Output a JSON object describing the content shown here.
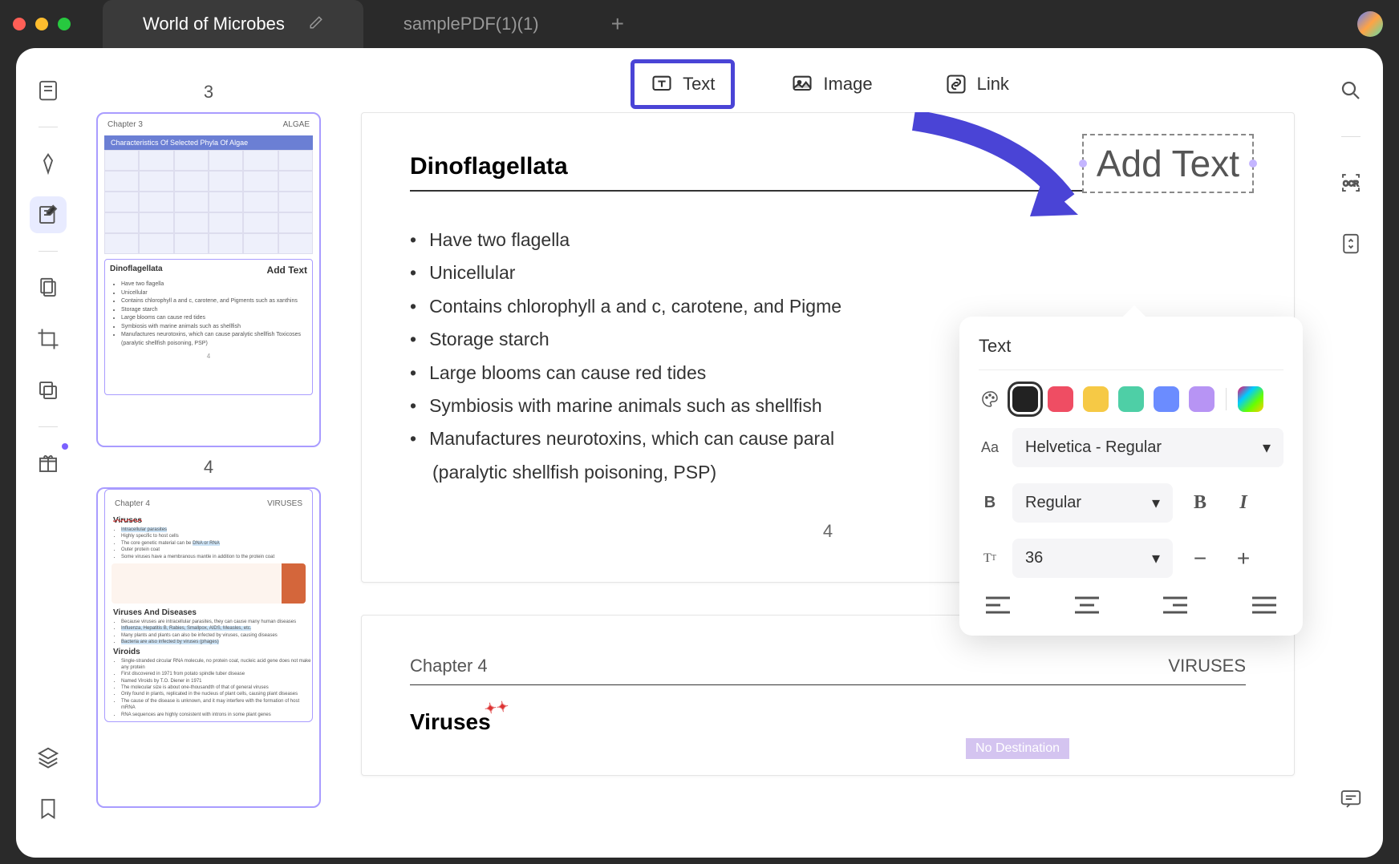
{
  "tabs": [
    {
      "label": "World of Microbes",
      "active": true
    },
    {
      "label": "samplePDF(1)(1)",
      "active": false
    }
  ],
  "thumbs": {
    "page3_label": "3",
    "page4_label": "4",
    "page4": {
      "chapter": "Chapter 3",
      "subject": "ALGAE",
      "table_title": "Characteristics Of Selected Phyla Of Algae",
      "dino_title": "Dinoflagellata",
      "add_text": "Add Text",
      "bullets": [
        "Have two flagella",
        "Unicellular",
        "Contains chlorophyll a and c, carotene, and Pigments such as xanthins",
        "Storage starch",
        "Large blooms can cause red tides",
        "Symbiosis with marine animals such as shellfish",
        "Manufactures neurotoxins, which can cause paralytic shellfish Toxicoses (paralytic shellfish poisoning, PSP)"
      ],
      "pgnum": "4"
    },
    "page5": {
      "chapter": "Chapter 4",
      "subject": "VIRUSES",
      "sec1": "Viruses",
      "sec2": "Viruses And Diseases",
      "sec3": "Viroids"
    }
  },
  "top_tools": {
    "text": "Text",
    "image": "Image",
    "link": "Link"
  },
  "page4": {
    "title": "Dinoflagellata",
    "add_text": "Add Text",
    "bullets": [
      "Have two flagella",
      "Unicellular",
      "Contains chlorophyll a and c, carotene, and Pigme",
      "Storage starch",
      "Large blooms can cause red tides",
      "Symbiosis with marine animals such as shellfish",
      "Manufactures neurotoxins, which can cause paral",
      "(paralytic shellfish poisoning, PSP)"
    ],
    "pgnum": "4"
  },
  "page5": {
    "chapter": "Chapter 4",
    "subject": "VIRUSES",
    "title": "Viruses",
    "nodest": "No Destination"
  },
  "text_popup": {
    "title": "Text",
    "colors": [
      "#222222",
      "#ef4d63",
      "#f6c945",
      "#4ecfa6",
      "#6b8cff",
      "#b794f4"
    ],
    "font": "Helvetica - Regular",
    "weight": "Regular",
    "size": "36"
  }
}
